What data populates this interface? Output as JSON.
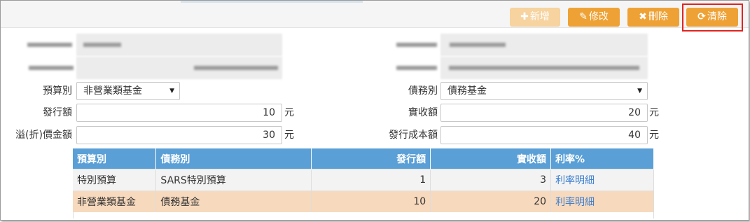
{
  "toolbar": {
    "add_label": "新增",
    "edit_label": "修改",
    "delete_label": "刪除",
    "clear_label": "清除"
  },
  "form": {
    "budget_type": {
      "label": "預算別",
      "value": "非營業類基金"
    },
    "debt_type": {
      "label": "債務別",
      "value": "債務基金"
    },
    "issue_amount": {
      "label": "發行額",
      "value": "10",
      "unit": "元"
    },
    "received_amount": {
      "label": "實收額",
      "value": "20",
      "unit": "元"
    },
    "premium_amount": {
      "label": "溢(折)價金額",
      "value": "30",
      "unit": "元"
    },
    "issue_cost": {
      "label": "發行成本額",
      "value": "40",
      "unit": "元"
    }
  },
  "grid": {
    "headers": [
      "預算別",
      "債務別",
      "發行額",
      "實收額",
      "利率%"
    ],
    "rows": [
      {
        "budget": "特別預算",
        "debt": "SARS特別預算",
        "issue": "1",
        "received": "3",
        "rate_link": "利率明細"
      },
      {
        "budget": "非營業類基金",
        "debt": "債務基金",
        "issue": "10",
        "received": "20",
        "rate_link": "利率明細"
      }
    ]
  }
}
